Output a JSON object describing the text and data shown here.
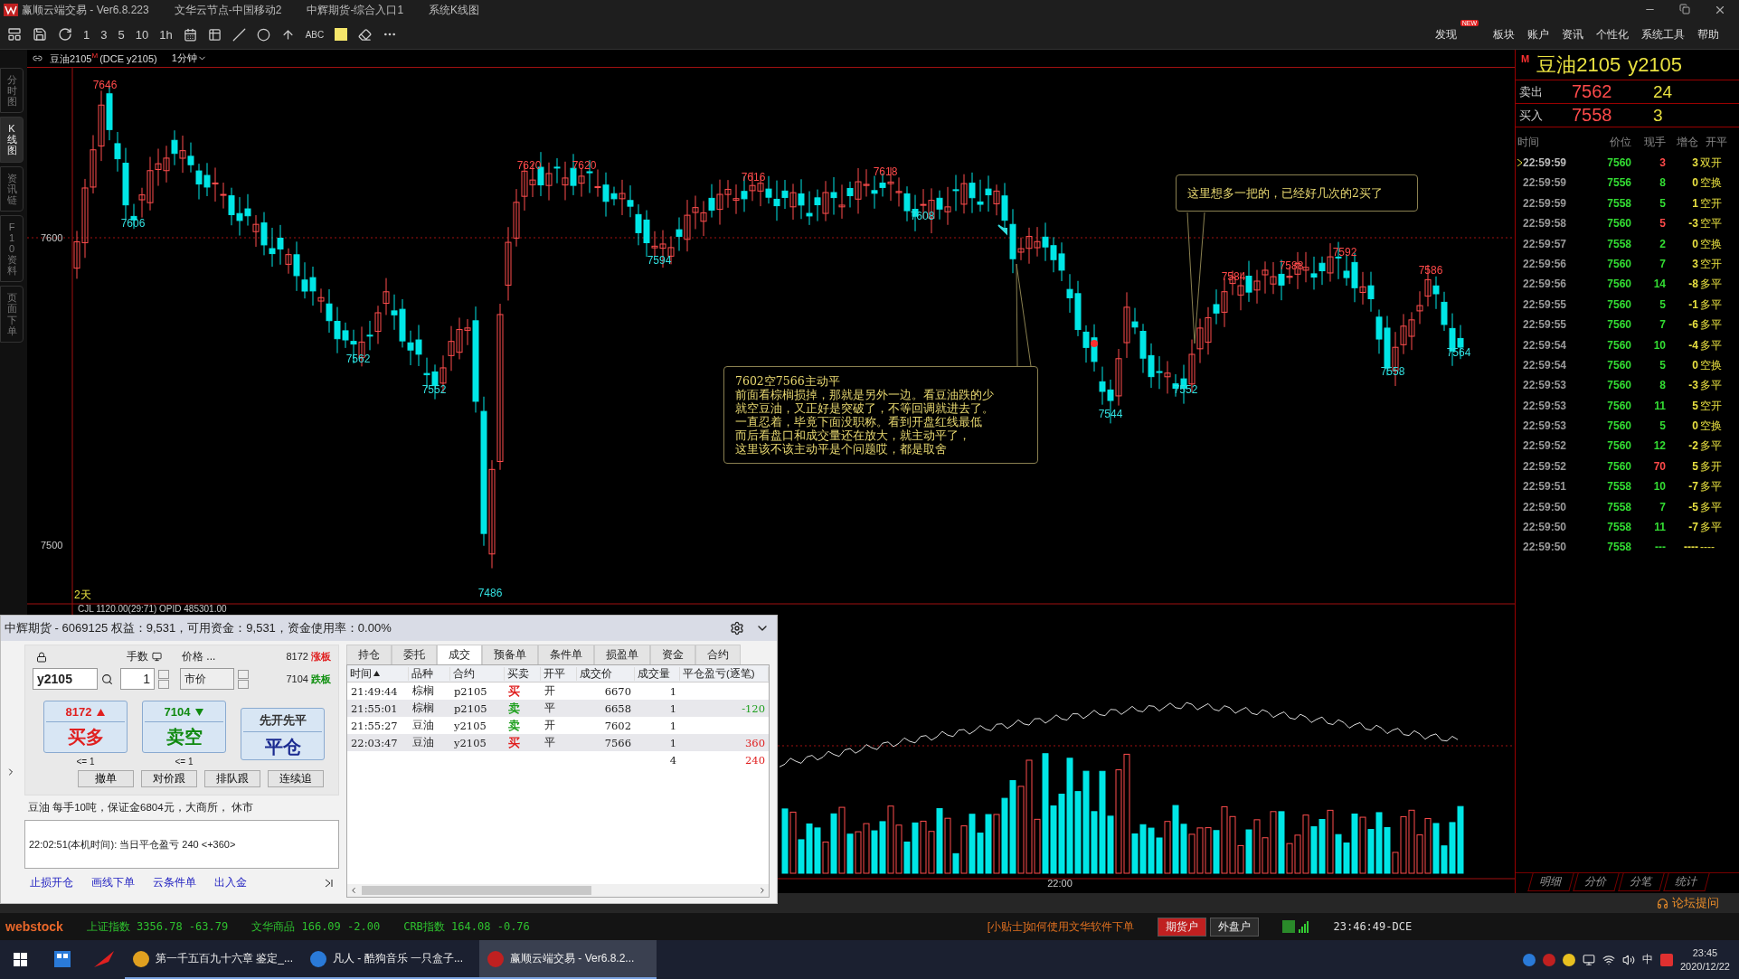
{
  "title_bar": {
    "app": "赢顺云端交易  - Ver6.8.223",
    "items": [
      "文华云节点-中国移动2",
      "中辉期货-综合入口1",
      "系统K线图"
    ]
  },
  "toolbar": {
    "periods": [
      "1",
      "3",
      "5",
      "10",
      "1h"
    ],
    "text_tool": "ABC"
  },
  "menu": [
    {
      "label": "发现",
      "badge": "NEW"
    },
    {
      "label": "板块"
    },
    {
      "label": "账户"
    },
    {
      "label": "资讯"
    },
    {
      "label": "个性化"
    },
    {
      "label": "系统工具"
    },
    {
      "label": "帮助"
    }
  ],
  "side_tabs": [
    {
      "label": "分时图",
      "selected": false
    },
    {
      "label": "K线图",
      "selected": true
    },
    {
      "label": "资讯链",
      "selected": false
    },
    {
      "label": "F10资料",
      "selected": false
    },
    {
      "label": "页面下单",
      "selected": false
    }
  ],
  "chart": {
    "symbol": "豆油2105",
    "symbol_mark": "M",
    "exchange": "(DCE y2105)",
    "period": "1分钟",
    "y_labels": [
      "7600",
      "7500"
    ],
    "price_marks": [
      {
        "label": "7646",
        "kind": "high"
      },
      {
        "label": "7606",
        "kind": "low"
      },
      {
        "label": "7562",
        "kind": "low"
      },
      {
        "label": "7552",
        "kind": "low"
      },
      {
        "label": "7486",
        "kind": "low"
      },
      {
        "label": "7620",
        "kind": "high"
      },
      {
        "label": "7620",
        "kind": "high"
      },
      {
        "label": "7594",
        "kind": "low"
      },
      {
        "label": "7616",
        "kind": "high"
      },
      {
        "label": "7618",
        "kind": "high"
      },
      {
        "label": "7608",
        "kind": "low"
      },
      {
        "label": "7544",
        "kind": "low"
      },
      {
        "label": "7552",
        "kind": "low"
      },
      {
        "label": "7584",
        "kind": "high"
      },
      {
        "label": "7588",
        "kind": "high"
      },
      {
        "label": "7592",
        "kind": "high"
      },
      {
        "label": "7586",
        "kind": "high"
      },
      {
        "label": "7558",
        "kind": "low"
      },
      {
        "label": "7564",
        "kind": "low"
      }
    ],
    "range_label": "2天",
    "indicator_line": "CJL  1120.00(29:71)  OPID 485301.00",
    "x_label": "22:00",
    "notes": [
      {
        "lines": [
          "7602空7566主动平",
          "前面看棕榈损掉，那就是另外一边。看豆油跌的少",
          "就空豆油，又正好是突破了，不等回调就进去了。",
          "一直忍着，毕竟下面没职称。看到开盘红线最低",
          "而后看盘口和成交量还在放大，就主动平了，",
          "这里该不该主动平是个问题哎，都是取舍"
        ]
      },
      {
        "lines": [
          "这里想多一把的，已经好几次的2买了"
        ]
      }
    ]
  },
  "quote": {
    "mark": "M",
    "name": "豆油2105",
    "code": "y2105",
    "ask": {
      "label": "卖出",
      "price": "7562",
      "size": "24"
    },
    "bid": {
      "label": "买入",
      "price": "7558",
      "size": "3"
    },
    "columns": [
      "时间",
      "价位",
      "现手",
      "增仓",
      "开平"
    ],
    "rows": [
      {
        "time": "22:59:59",
        "price": "7560",
        "vol": "3",
        "color": "#ff4a4a",
        "oi": "3",
        "type": "双开",
        "selected": true
      },
      {
        "time": "22:59:59",
        "price": "7556",
        "vol": "8",
        "color": "#33dd33",
        "oi": "0",
        "type": "空换",
        "selected": false
      },
      {
        "time": "22:59:59",
        "price": "7558",
        "vol": "5",
        "color": "#33dd33",
        "oi": "1",
        "type": "空开",
        "selected": false
      },
      {
        "time": "22:59:58",
        "price": "7560",
        "vol": "5",
        "color": "#ff4a4a",
        "oi": "-3",
        "type": "空平",
        "selected": false
      },
      {
        "time": "22:59:57",
        "price": "7558",
        "vol": "2",
        "color": "#33dd33",
        "oi": "0",
        "type": "空换",
        "selected": false
      },
      {
        "time": "22:59:56",
        "price": "7560",
        "vol": "7",
        "color": "#33dd33",
        "oi": "3",
        "type": "空开",
        "selected": false
      },
      {
        "time": "22:59:56",
        "price": "7560",
        "vol": "14",
        "color": "#33dd33",
        "oi": "-8",
        "type": "多平",
        "selected": false
      },
      {
        "time": "22:59:55",
        "price": "7560",
        "vol": "5",
        "color": "#33dd33",
        "oi": "-1",
        "type": "多平",
        "selected": false
      },
      {
        "time": "22:59:55",
        "price": "7560",
        "vol": "7",
        "color": "#33dd33",
        "oi": "-6",
        "type": "多平",
        "selected": false
      },
      {
        "time": "22:59:54",
        "price": "7560",
        "vol": "10",
        "color": "#33dd33",
        "oi": "-4",
        "type": "多平",
        "selected": false
      },
      {
        "time": "22:59:54",
        "price": "7560",
        "vol": "5",
        "color": "#33dd33",
        "oi": "0",
        "type": "空换",
        "selected": false
      },
      {
        "time": "22:59:53",
        "price": "7560",
        "vol": "8",
        "color": "#33dd33",
        "oi": "-3",
        "type": "多平",
        "selected": false
      },
      {
        "time": "22:59:53",
        "price": "7560",
        "vol": "11",
        "color": "#33dd33",
        "oi": "5",
        "type": "空开",
        "selected": false
      },
      {
        "time": "22:59:53",
        "price": "7560",
        "vol": "5",
        "color": "#33dd33",
        "oi": "0",
        "type": "空换",
        "selected": false
      },
      {
        "time": "22:59:52",
        "price": "7560",
        "vol": "12",
        "color": "#33dd33",
        "oi": "-2",
        "type": "多平",
        "selected": false
      },
      {
        "time": "22:59:52",
        "price": "7560",
        "vol": "70",
        "color": "#ff4a4a",
        "oi": "5",
        "type": "多开",
        "selected": false
      },
      {
        "time": "22:59:51",
        "price": "7558",
        "vol": "10",
        "color": "#33dd33",
        "oi": "-7",
        "type": "多平",
        "selected": false
      },
      {
        "time": "22:59:50",
        "price": "7558",
        "vol": "7",
        "color": "#33dd33",
        "oi": "-5",
        "type": "多平",
        "selected": false
      },
      {
        "time": "22:59:50",
        "price": "7558",
        "vol": "11",
        "color": "#33dd33",
        "oi": "-7",
        "type": "多平",
        "selected": false
      },
      {
        "time": "22:59:50",
        "price": "7558",
        "vol": "---",
        "color": "#33dd33",
        "oi": "----",
        "type": "----",
        "selected": false
      }
    ],
    "tabs": [
      "明细",
      "分价",
      "分笔",
      "统计"
    ]
  },
  "forum_link": "论坛提问",
  "order_panel": {
    "title": "中辉期货 - 6069125  权益：9,531，可用资金：9,531，资金使用率：0.00%",
    "qty_label": "手数",
    "price_label": "价格 ...",
    "symbol_value": "y2105",
    "qty_value": "1",
    "price_value": "市价",
    "limit_up": {
      "price": "8172",
      "label": "涨板"
    },
    "limit_down": {
      "price": "7104",
      "label": "跌板"
    },
    "actions": [
      {
        "kind": "buy",
        "price": "8172",
        "label": "买多",
        "hint": "<= 1"
      },
      {
        "kind": "sell",
        "price": "7104",
        "label": "卖空",
        "hint": "<= 1"
      },
      {
        "kind": "close",
        "price": "先开先平",
        "label": "平仓"
      }
    ],
    "quick_buttons": [
      "撤单",
      "对价跟",
      "排队跟",
      "连续追"
    ],
    "info": "豆油 每手10吨，保证金6804元，大商所， 休市",
    "message": "22:02:51(本机时间): 当日平仓盈亏 240  <+360>",
    "links": [
      "止损开仓",
      "画线下单",
      "云条件单",
      "出入金"
    ],
    "tabs": [
      {
        "label": "持仓",
        "selected": false
      },
      {
        "label": "委托",
        "selected": false
      },
      {
        "label": "成交",
        "selected": true
      },
      {
        "label": "预备单",
        "selected": false
      },
      {
        "label": "条件单",
        "selected": false
      },
      {
        "label": "损盈单",
        "selected": false
      },
      {
        "label": "资金",
        "selected": false
      },
      {
        "label": "合约",
        "selected": false
      }
    ],
    "columns": [
      {
        "label": "时间",
        "sorted": true
      },
      {
        "label": "品种",
        "sorted": false
      },
      {
        "label": "合约",
        "sorted": false
      },
      {
        "label": "买卖",
        "sorted": false
      },
      {
        "label": "开平",
        "sorted": false
      },
      {
        "label": "成交价",
        "sorted": false
      },
      {
        "label": "成交量",
        "sorted": false
      },
      {
        "label": "平仓盈亏(逐笔)",
        "sorted": false
      }
    ],
    "rows": [
      {
        "time": "21:49:44",
        "product": "棕榈",
        "contract": "p2105",
        "side": {
          "label": "买",
          "color": "#e02020"
        },
        "offset": "开",
        "price": "6670",
        "qty": "1"
      },
      {
        "time": "21:55:01",
        "product": "棕榈",
        "contract": "p2105",
        "side": {
          "label": "卖",
          "color": "#20a020"
        },
        "offset": "平",
        "price": "6658",
        "qty": "1",
        "pnl": "-120",
        "profit": false
      },
      {
        "time": "21:55:27",
        "product": "豆油",
        "contract": "y2105",
        "side": {
          "label": "卖",
          "color": "#20a020"
        },
        "offset": "开",
        "price": "7602",
        "qty": "1"
      },
      {
        "time": "22:03:47",
        "product": "豆油",
        "contract": "y2105",
        "side": {
          "label": "买",
          "color": "#e02020"
        },
        "offset": "平",
        "price": "7566",
        "qty": "1",
        "pnl": "360",
        "profit": true
      }
    ],
    "total": {
      "qty": "4",
      "pnl": "240",
      "profit": true
    }
  },
  "status_bar": {
    "logo": "webstock",
    "indices": [
      {
        "name": "上证指数",
        "value": "3356.78",
        "change": "-63.79"
      },
      {
        "name": "文华商品",
        "value": "166.09",
        "change": "-2.00"
      },
      {
        "name": "CRB指数",
        "value": "164.08",
        "change": "-0.76"
      }
    ],
    "tip": "[小贴士]如何使用文华软件下单",
    "accounts": [
      {
        "label": "期货户",
        "selected": true
      },
      {
        "label": "外盘户",
        "selected": false
      }
    ],
    "clock": "23:46:49-DCE"
  },
  "taskbar": {
    "tasks": [
      {
        "label": "第一千五百九十六章 鉴定_...",
        "selected": false
      },
      {
        "label": "凡人 - 酷狗音乐 一只盒子...",
        "selected": false
      },
      {
        "label": "赢顺云端交易  - Ver6.8.2...",
        "selected": true
      }
    ],
    "ime": "中",
    "time": "23:45",
    "date": "2020/12/22"
  }
}
